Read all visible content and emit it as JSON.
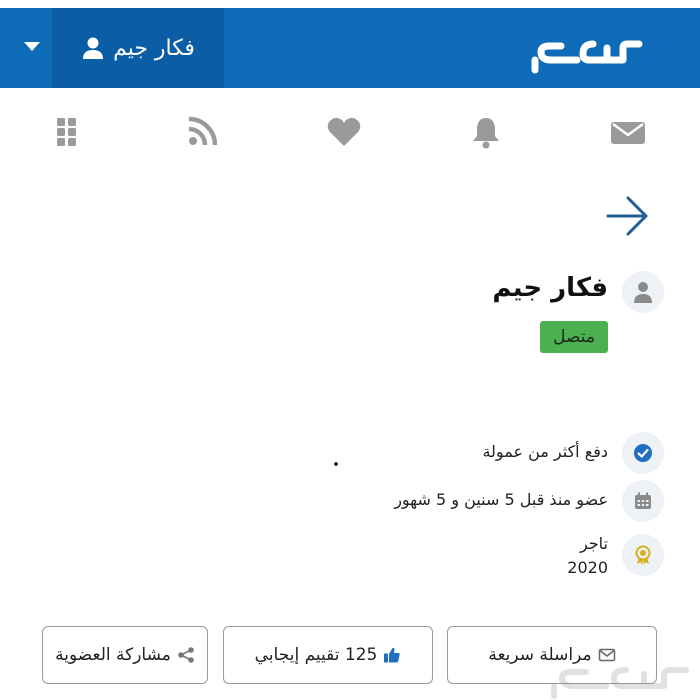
{
  "header": {
    "logo_icon": "haraj-logo",
    "user_name": "فكار جيم",
    "user_icon": "user-icon",
    "menu_icon": "caret-down-icon",
    "background": "#0e6bb8"
  },
  "toolbar": {
    "items": [
      {
        "name": "messages",
        "icon": "envelope-icon"
      },
      {
        "name": "notifications",
        "icon": "bell-icon"
      },
      {
        "name": "favorites",
        "icon": "heart-icon"
      },
      {
        "name": "feed",
        "icon": "rss-icon"
      },
      {
        "name": "apps",
        "icon": "grid-icon"
      }
    ]
  },
  "profile": {
    "name": "فكار جيم",
    "status": "متصل",
    "status_color": "#4caf50"
  },
  "info": {
    "commission": "دفع أكثر من عمولة",
    "member_since": "عضو منذ قبل 5 سنين و 5 شهور",
    "merchant_label": "تاجر",
    "merchant_year": "2020"
  },
  "actions": {
    "quick_message": "مراسلة سريعة",
    "rating": "125 تقييم إيجابي",
    "share": "مشاركة العضوية"
  },
  "colors": {
    "accent": "#0e6bb8",
    "verified": "#1e6fc0",
    "award": "#d4b21d"
  }
}
